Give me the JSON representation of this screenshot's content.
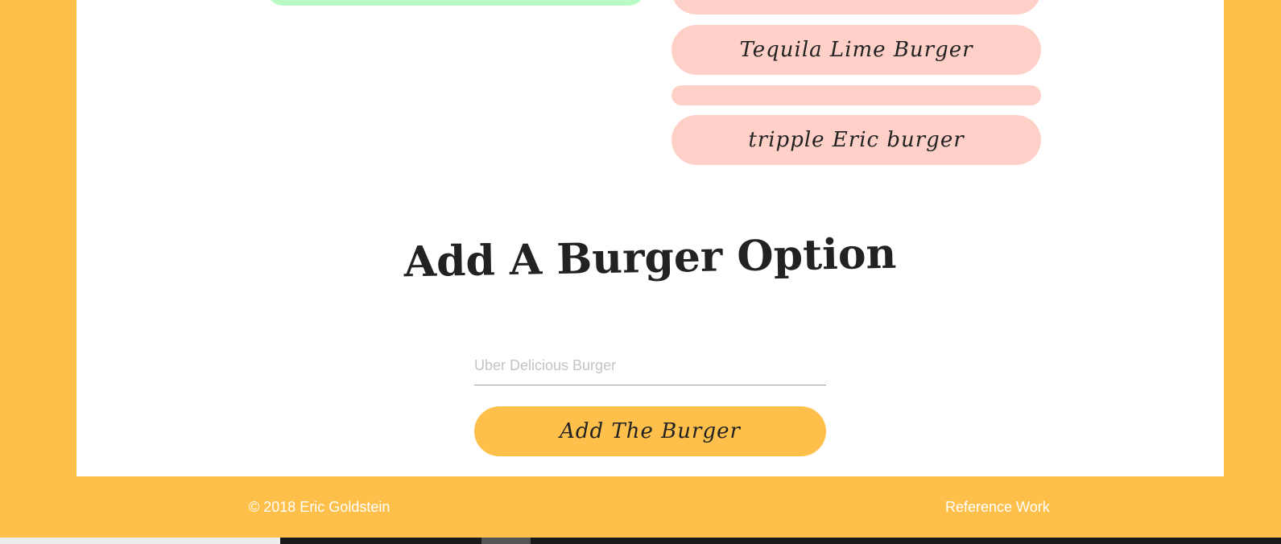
{
  "burger_list": {
    "items": [
      {
        "label": ""
      },
      {
        "label": "Tequila Lime Burger"
      },
      {
        "label": ""
      },
      {
        "label": "tripple Eric burger"
      }
    ]
  },
  "add_section": {
    "title": "Add A Burger Option",
    "input_placeholder": "Uber Delicious Burger",
    "input_value": "",
    "submit_label": "Add The Burger"
  },
  "footer": {
    "copyright": "© 2018 Eric Goldstein",
    "link_label": "Reference Work"
  },
  "colors": {
    "page_background": "#FFC04B",
    "card_background": "#FFFFFF",
    "burger_item": "#FFD0C8",
    "devoured_item": "#B8FBC5",
    "accent": "#FFC04B"
  }
}
